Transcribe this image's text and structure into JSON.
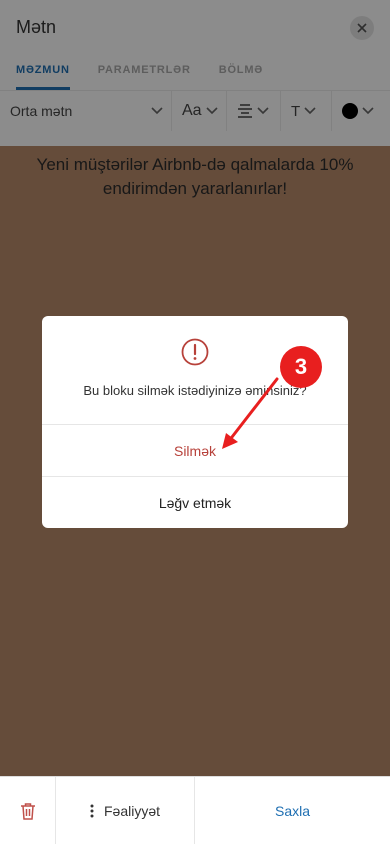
{
  "header": {
    "title": "Mətn",
    "close_icon": "close-icon"
  },
  "tabs": [
    {
      "label": "MƏZMUN",
      "active": true
    },
    {
      "label": "PARAMETRLƏR",
      "active": false
    },
    {
      "label": "BÖLMƏ",
      "active": false
    }
  ],
  "toolbar": {
    "font_style": "Orta mətn",
    "font_size_label": "Aa",
    "align_icon": "align-center-icon",
    "transform_label": "T",
    "text_color": "#000000"
  },
  "canvas": {
    "background": "#b88a6a",
    "text": "Yeni müştərilər Airbnb-də qalmalarda 10% endirimdən yararlanırlar!"
  },
  "dialog": {
    "icon": "warning-icon",
    "message": "Bu bloku silmək istədiyinizə əminsiniz?",
    "confirm_label": "Silmək",
    "cancel_label": "Ləğv etmək"
  },
  "annotation": {
    "step_number": "3"
  },
  "bottom_bar": {
    "delete_icon": "trash-icon",
    "actions_label": "Fəaliyyət",
    "save_label": "Saxla"
  },
  "colors": {
    "accent": "#1f6fb2",
    "danger": "#b7413a",
    "badge": "#e81f1f"
  }
}
